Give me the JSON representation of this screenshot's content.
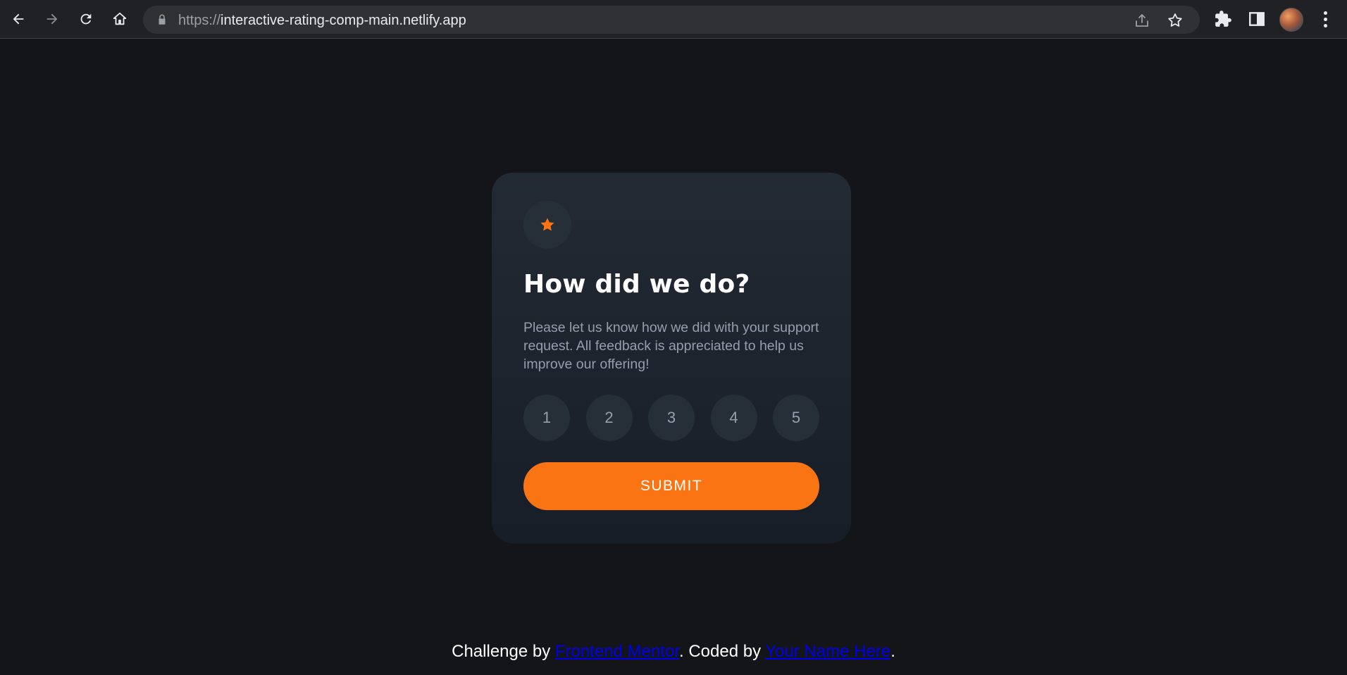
{
  "browser": {
    "url_scheme": "https://",
    "url_host": "interactive-rating-comp-main.netlify.app",
    "icons": [
      "back-arrow-icon",
      "forward-arrow-icon",
      "reload-icon",
      "home-icon",
      "lock-icon",
      "share-icon",
      "bookmark-star-icon",
      "extensions-puzzle-icon",
      "side-panel-icon",
      "profile-avatar",
      "kebab-menu-icon"
    ]
  },
  "card": {
    "icon": "star-icon",
    "title": "How did we do?",
    "description": "Please let us know how we did with your support request. All feedback is appreciated to help us improve our offering!",
    "ratings": [
      "1",
      "2",
      "3",
      "4",
      "5"
    ],
    "submit_label": "SUBMIT"
  },
  "attribution": {
    "prefix": "Challenge by ",
    "link1": "Frontend Mentor",
    "middle": ". Coded by ",
    "link2": "Your Name Here",
    "suffix": "."
  },
  "colors": {
    "page_bg": "#131518",
    "card_bg": "#232a34",
    "accent": "#fb7413",
    "muted_text": "#959eac",
    "link": "#0000ee"
  }
}
